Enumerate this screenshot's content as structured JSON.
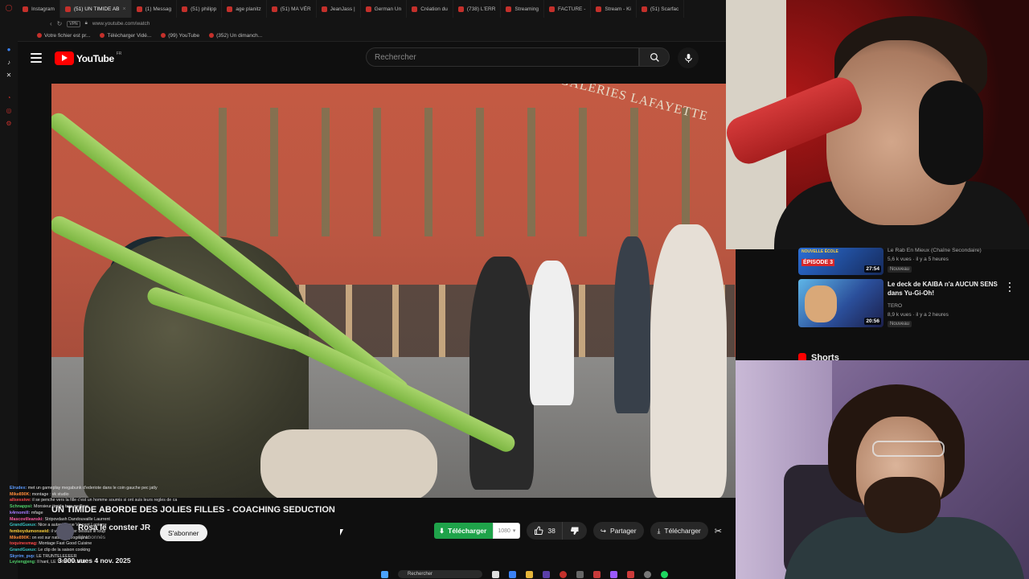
{
  "browser": {
    "tabs": [
      {
        "label": "Instagram"
      },
      {
        "label": "(51) UN TIMIDE AB"
      },
      {
        "label": "(1) Messag"
      },
      {
        "label": "(51) philipp"
      },
      {
        "label": "age planitz"
      },
      {
        "label": "(51) MA VÉR"
      },
      {
        "label": "JeanJass |"
      },
      {
        "label": "German Un"
      },
      {
        "label": "Création du"
      },
      {
        "label": "(738) L'ERR"
      },
      {
        "label": "Streaming"
      },
      {
        "label": "FACTURE -"
      },
      {
        "label": "Stream - Ki"
      },
      {
        "label": "(51) Scarfac"
      }
    ],
    "address": "www.youtube.com/watch",
    "vpn_label": "VPN",
    "bookmarks": [
      {
        "label": "Votre fichier est pr..."
      },
      {
        "label": "Télécharger Vidé..."
      },
      {
        "label": "(99) YouTube"
      },
      {
        "label": "(352) Un dimanch..."
      }
    ]
  },
  "youtube": {
    "wordmark": "YouTube",
    "country": "FR",
    "search_placeholder": "Rechercher"
  },
  "video": {
    "store_sign": "GALERIES LAFAYETTE",
    "title": "UN TIMIDE ABORDE DES JOLIES FILLES - COACHING SEDUCTION",
    "channel": "Rosa le conster JR",
    "subscribers": "81 abonnés",
    "subscribe_label": "S'abonner",
    "meta": "3 000 vues  4 nov. 2025",
    "download_green": "Télécharger",
    "quality": "1080",
    "likes": "38",
    "share_label": "Partager",
    "download_label": "Télécharger"
  },
  "chat": [
    {
      "user": "Elrudex:",
      "msg": "met un gameplay megabunk d'ederiote dans le coin gauche pec jatly",
      "color": "#5b9bff"
    },
    {
      "user": "Mike890K:",
      "msg": "montage : vk studio",
      "color": "#ff8c3a"
    },
    {
      "user": "allsessive:",
      "msg": "il se penche vers la fille c'est un homme soumis si ont suis leurs regles de ca",
      "color": "#ff4a4a"
    },
    {
      "user": "Schnappsi:",
      "msg": "Monsieur timide trop meilleur",
      "color": "#4fd16a"
    },
    {
      "user": "k4rnomill:",
      "msg": "mfage",
      "color": "#a67bff"
    },
    {
      "user": "Mascovilleanski:",
      "msg": "Stripovdash Dandouvaille Laurrent",
      "color": "#ff5aa5"
    },
    {
      "user": "GrandGueux:",
      "msg": "Nice a autant il que Vincent Lapierre",
      "color": "#36c2c2"
    },
    {
      "user": "femboydumonswid:",
      "msg": "il va lui sauter dessus le loup",
      "color": "#ffd23a"
    },
    {
      "user": "Mike890K:",
      "msg": "on est sur national geographic",
      "color": "#ff8c3a"
    },
    {
      "user": "toquinesmag:",
      "msg": "Montage Fast Good Cuisine",
      "color": "#ff4a4a"
    },
    {
      "user": "GrandGueux:",
      "msg": "Le clip de la saison cooking",
      "color": "#36c2c2"
    },
    {
      "user": "Skyrim_pvp:",
      "msg": "LE TRUNTELEEEER",
      "color": "#5b9bff"
    },
    {
      "user": "Leyiengjeng:",
      "msg": "Il hanl, LE TRUNTELEER",
      "color": "#4fd16a"
    }
  ],
  "taskbar": {
    "search_label": "Rechercher"
  },
  "sidebar": {
    "recs": [
      {
        "title": "Le Rab En Mieux (Chaîne Secondaire)",
        "channel": "",
        "stats": "5,6 k vues · il y a 5 heures",
        "badge": "Nouveau",
        "duration": "27:54",
        "thumb_text": "ÉPISODE 3",
        "thumb_text2": "NOUVELLE ÉCOLE"
      },
      {
        "title": "Le deck de KAIBA n'a AUCUN SENS dans Yu-Gi-Oh!",
        "channel": "TERO",
        "stats": "8,9 k vues · il y a 2 heures",
        "badge": "Nouveau",
        "duration": "20:56"
      }
    ],
    "shorts_label": "Shorts"
  },
  "colors": {
    "yt_red": "#ff0000",
    "download_green": "#1fa34a",
    "bg": "#0f0f0f"
  }
}
